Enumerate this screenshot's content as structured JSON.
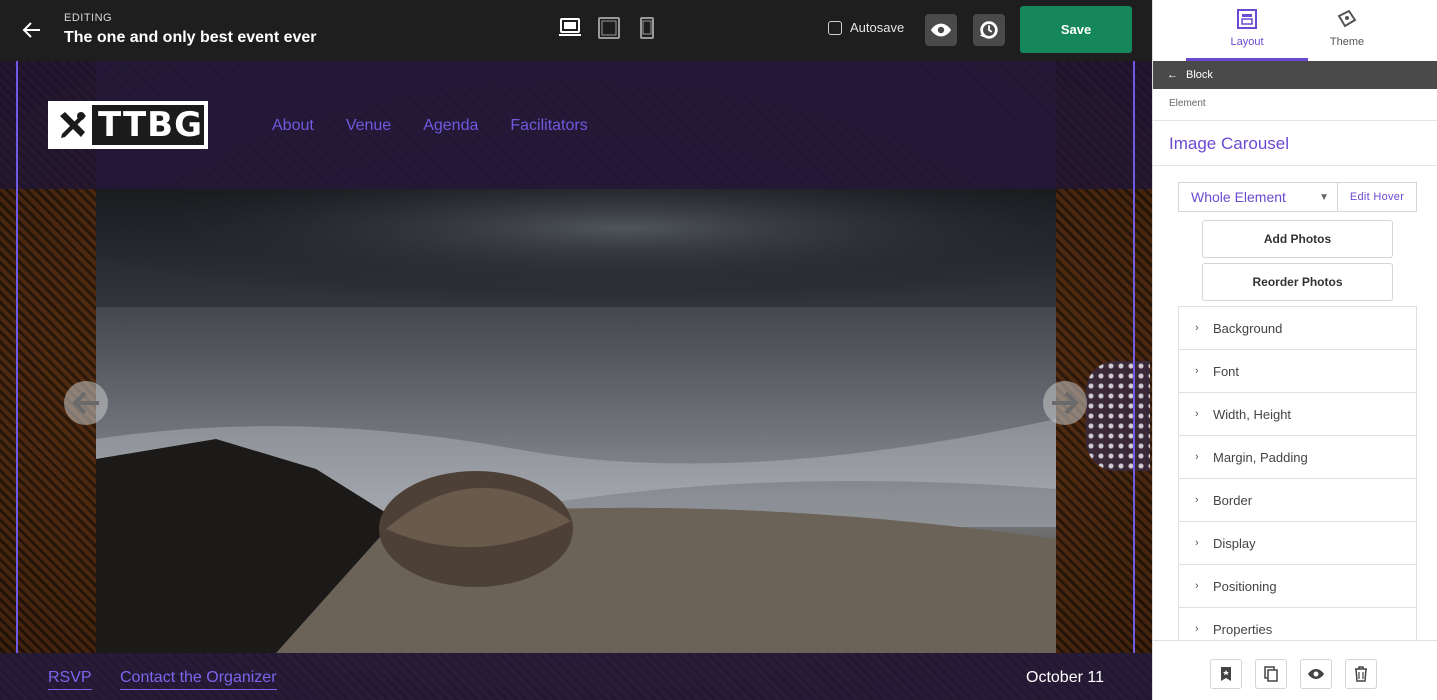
{
  "topbar": {
    "editing_label": "EDITING",
    "event_title": "The one and only best event ever",
    "autosave_label": "Autosave",
    "save_label": "Save",
    "icons": [
      "back-arrow-icon",
      "desktop-icon",
      "tablet-icon",
      "mobile-icon",
      "eye-icon",
      "history-icon"
    ]
  },
  "site": {
    "logo_text": "TTBG",
    "nav": [
      "About",
      "Venue",
      "Agenda",
      "Facilitators"
    ],
    "footer_links": [
      "RSVP",
      "Contact the Organizer"
    ],
    "date": "October 11"
  },
  "panel": {
    "tabs": [
      {
        "label": "Layout",
        "icon": "layout-icon",
        "active": true
      },
      {
        "label": "Theme",
        "icon": "theme-icon",
        "active": false
      }
    ],
    "back_label": "Block",
    "breadcrumb": "Element",
    "element_title": "Image Carousel",
    "scope_select": "Whole Element",
    "edit_hover": "Edit Hover",
    "add_photos": "Add Photos",
    "reorder_photos": "Reorder Photos",
    "sections": [
      "Background",
      "Font",
      "Width, Height",
      "Margin, Padding",
      "Border",
      "Display",
      "Positioning",
      "Properties"
    ],
    "footer_icons": [
      "bookmark-icon",
      "duplicate-icon",
      "visibility-icon",
      "trash-icon"
    ]
  },
  "colors": {
    "accent": "#6a4ad0",
    "nav_link": "#6f5ae0",
    "save_green": "#15875a",
    "topbar": "#1e1e1e"
  }
}
